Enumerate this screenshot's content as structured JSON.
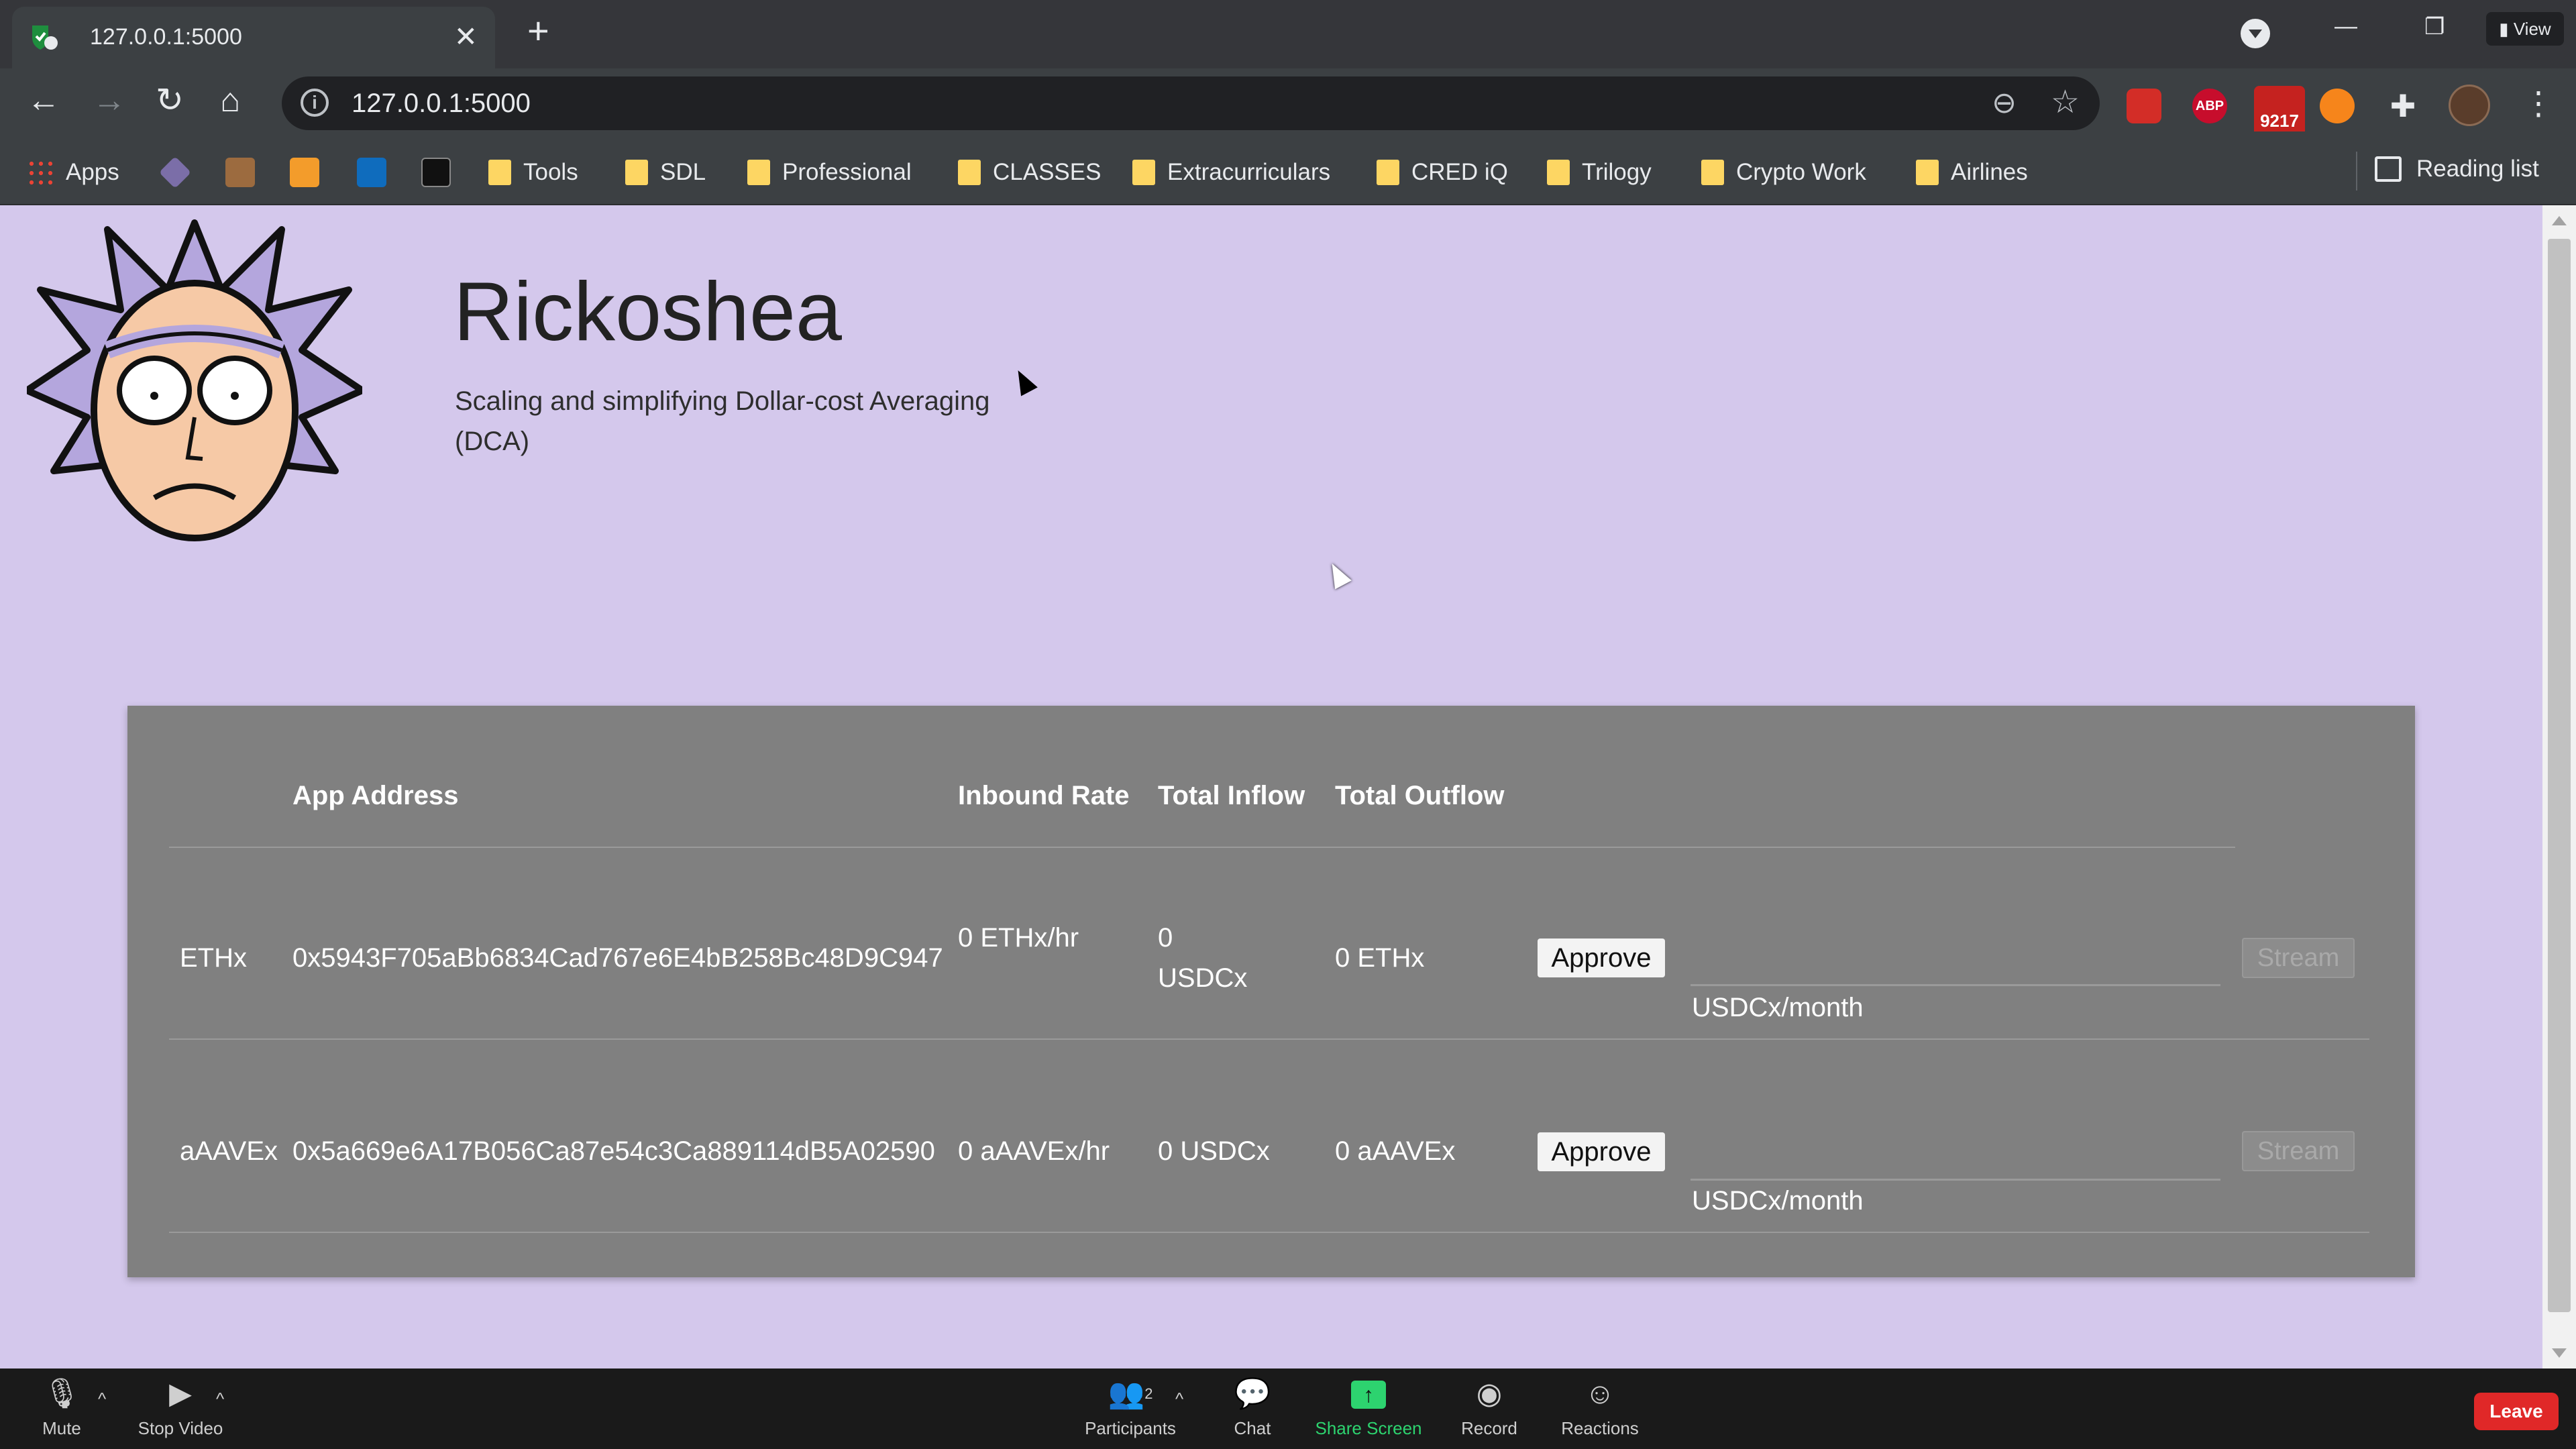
{
  "browser": {
    "tab_title": "127.0.0.1:5000",
    "tab_close": "✕",
    "new_tab": "+",
    "view_label": "View",
    "url": "127.0.0.1:5000",
    "mail_badge": "9217",
    "abp_label": "ABP"
  },
  "bookmarks": {
    "apps": "Apps",
    "items": [
      "Tools",
      "SDL",
      "Professional",
      "CLASSES",
      "Extracurriculars",
      "CRED iQ",
      "Trilogy",
      "Crypto Work",
      "Airlines"
    ],
    "reading_list": "Reading list"
  },
  "page": {
    "title": "Rickoshea",
    "tagline": "Scaling and simplifying Dollar-cost Averaging (DCA)",
    "table": {
      "headers": {
        "app_address": "App Address",
        "inbound_rate": "Inbound Rate",
        "total_inflow": "Total Inflow",
        "total_outflow": "Total Outflow"
      },
      "rows": [
        {
          "token": "ETHx",
          "address": "0x5943F705aBb6834Cad767e6E4bB258Bc48D9C947",
          "inbound_rate": "0 ETHx/hr",
          "total_inflow": "0 USDCx",
          "total_outflow": "0 ETHx",
          "approve": "Approve",
          "rate_unit": "USDCx/month",
          "stream": "Stream"
        },
        {
          "token": "aAAVEx",
          "address": "0x5a669e6A17B056Ca87e54c3Ca889114dB5A02590",
          "inbound_rate": "0 aAAVEx/hr",
          "total_inflow": "0 USDCx",
          "total_outflow": "0 aAAVEx",
          "approve": "Approve",
          "rate_unit": "USDCx/month",
          "stream": "Stream"
        }
      ]
    }
  },
  "zoom": {
    "mute": "Mute",
    "stop_video": "Stop Video",
    "participants": "Participants",
    "participants_count": "2",
    "chat": "Chat",
    "share_screen": "Share Screen",
    "record": "Record",
    "reactions": "Reactions",
    "leave": "Leave"
  },
  "colors": {
    "page_bg": "#d4c8ec",
    "panel_bg": "#808080",
    "share_green": "#2dd36f",
    "leave_red": "#e02828"
  }
}
